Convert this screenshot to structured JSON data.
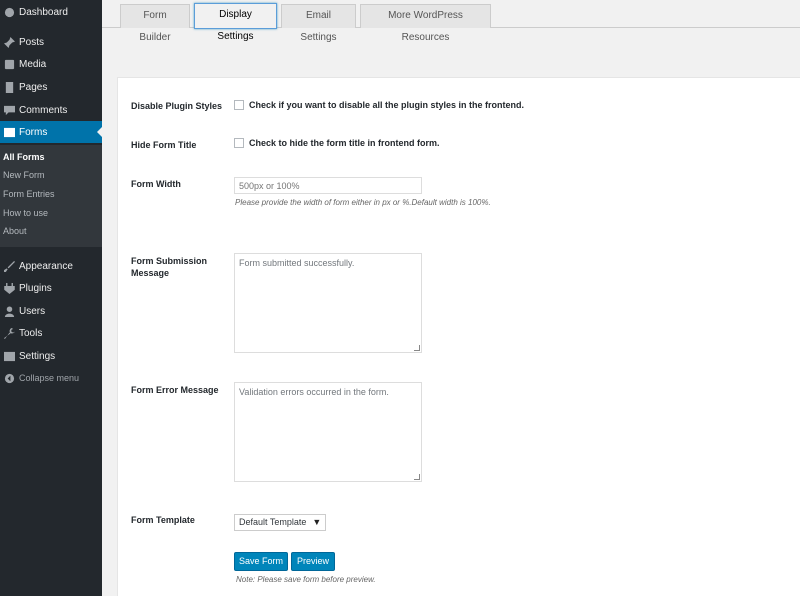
{
  "sidebar": {
    "menu": [
      {
        "label": "Dashboard",
        "icon": "dashboard-icon"
      },
      {
        "label": "Posts",
        "icon": "pin-icon"
      },
      {
        "label": "Media",
        "icon": "media-icon"
      },
      {
        "label": "Pages",
        "icon": "pages-icon"
      },
      {
        "label": "Comments",
        "icon": "comment-icon"
      },
      {
        "label": "Forms",
        "icon": "forms-icon"
      }
    ],
    "submenu": [
      "All Forms",
      "New Form",
      "Form Entries",
      "How to use",
      "About"
    ],
    "menu_bottom": [
      {
        "label": "Appearance",
        "icon": "brush-icon"
      },
      {
        "label": "Plugins",
        "icon": "plugin-icon"
      },
      {
        "label": "Users",
        "icon": "user-icon"
      },
      {
        "label": "Tools",
        "icon": "wrench-icon"
      },
      {
        "label": "Settings",
        "icon": "settings-icon"
      }
    ],
    "collapse": "Collapse menu"
  },
  "tabs": [
    "Form Builder",
    "Display Settings",
    "Email Settings",
    "More WordPress Resources"
  ],
  "form": {
    "disable_styles": {
      "label": "Disable Plugin Styles",
      "text": "Check if you want to disable all the plugin styles in the frontend."
    },
    "hide_title": {
      "label": "Hide Form Title",
      "text": "Check to hide the form title in frontend form."
    },
    "width": {
      "label": "Form Width",
      "placeholder": "500px or 100%",
      "help": "Please provide the width of form either in px or %.Default width is 100%."
    },
    "submission": {
      "label_line1": "Form Submission",
      "label_line2": "Message",
      "placeholder": "Form submitted successfully."
    },
    "error": {
      "label": "Form Error Message",
      "placeholder": "Validation errors occurred in the form."
    },
    "template": {
      "label": "Form Template",
      "value": "Default Template"
    },
    "save_label": "Save Form",
    "preview_label": "Preview",
    "note": "Note: Please save form before preview."
  },
  "colors": {
    "sidebar": "#23282d",
    "active": "#0073aa",
    "button": "#0085ba"
  }
}
